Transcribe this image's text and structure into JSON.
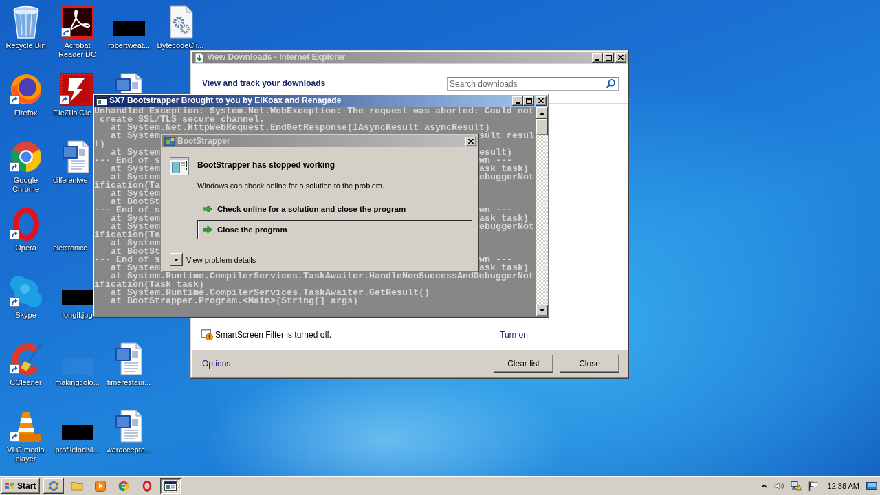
{
  "desktop_icons": [
    {
      "kind": "recyclebin",
      "label": "Recycle Bin",
      "shortcut": false
    },
    {
      "kind": "acrobat",
      "label": "Acrobat Reader DC",
      "shortcut": true
    },
    {
      "kind": "blackimage",
      "label": "robertweat...",
      "shortcut": false
    },
    {
      "kind": "bytecode",
      "label": "BytecodeCli...",
      "shortcut": false
    },
    {
      "kind": "firefox",
      "label": "Firefox",
      "shortcut": true
    },
    {
      "kind": "filezilla",
      "label": "FileZilla Clie",
      "shortcut": true
    },
    {
      "kind": "document",
      "shortcut": false
    },
    {
      "kind": "chrome",
      "label": "Google Chrome",
      "shortcut": true
    },
    {
      "kind": "document",
      "label": "differentwe",
      "shortcut": false
    },
    {
      "kind": "opera",
      "label": "Opera",
      "shortcut": true
    },
    {
      "kind": "blankimage",
      "label": "electronice",
      "shortcut": false
    },
    {
      "kind": "skype",
      "label": "Skype",
      "shortcut": true
    },
    {
      "kind": "blackimage",
      "label": "longfl.jpg",
      "shortcut": false
    },
    {
      "kind": "ccleaner",
      "label": "CCleaner",
      "shortcut": true
    },
    {
      "kind": "faintimage",
      "label": "makingcolo...",
      "shortcut": false
    },
    {
      "kind": "document",
      "label": "timerestaur...",
      "shortcut": false
    },
    {
      "kind": "vlc",
      "label": "VLC media player",
      "shortcut": true
    },
    {
      "kind": "blackimage",
      "label": "profileindivi...",
      "shortcut": false
    },
    {
      "kind": "document",
      "label": "waraccepte...",
      "shortcut": false
    }
  ],
  "downloads_window": {
    "title": "View Downloads - Internet Explorer",
    "active": false,
    "heading": "View and track your downloads",
    "search": {
      "placeholder": "Search downloads"
    },
    "smartscreen": {
      "message": "SmartScreen Filter is turned off.",
      "link": "Turn on"
    },
    "options_link": "Options",
    "buttons": [
      "Clear list",
      "Close"
    ]
  },
  "console_window": {
    "title": "SX7 Bootstrapper Brought to you by ElKoax and Renagade",
    "active": true,
    "lines": [
      {
        "text": "Unhandled Exception: System.Net.WebException: The request was aborted: Could not"
      },
      {
        "text": " create SSL/TLS secure channel."
      },
      {
        "text": "   at System.Net.HttpWebRequest.EndGetResponse(IAsyncResult asyncResult)"
      },
      {
        "left": "   at System",
        "right": "sult resul"
      },
      {
        "left": "t)"
      },
      {
        "left": "   at System",
        "right": "esult)"
      },
      {
        "left": "--- End of s",
        "right": "wn ---"
      },
      {
        "left": "   at System",
        "right": "ask task)"
      },
      {
        "left": "   at System",
        "right": "ebuggerNot"
      },
      {
        "left": "ification(Ta"
      },
      {
        "left": "   at System"
      },
      {
        "left": "   at BootSt"
      },
      {
        "left": "--- End of s",
        "right": "wn ---"
      },
      {
        "left": "   at System",
        "right": "ask task)"
      },
      {
        "left": "   at System",
        "right": "ebuggerNot"
      },
      {
        "left": "ification(Ta"
      },
      {
        "left": "   at System"
      },
      {
        "left": "   at BootSt"
      },
      {
        "left": "--- End of s",
        "right": "wn ---"
      },
      {
        "left": "   at System",
        "right": "ask task)"
      },
      {
        "text": "   at System.Runtime.CompilerServices.TaskAwaiter.HandleNonSuccessAndDebuggerNot"
      },
      {
        "text": "ification(Task task)"
      },
      {
        "text": "   at System.Runtime.CompilerServices.TaskAwaiter.GetResult()"
      },
      {
        "text": "   at BootStrapper.Program.<Main>(String[] args)"
      }
    ]
  },
  "error_dialog": {
    "title": "BootStrapper",
    "active": false,
    "heading": "BootStrapper has stopped working",
    "message": "Windows can check online for a solution to the problem.",
    "options": [
      {
        "label": "Check online for a solution and close the program",
        "selected": false
      },
      {
        "label": "Close the program",
        "selected": true
      }
    ],
    "details_toggle": {
      "label": "View problem details",
      "expanded": false
    }
  },
  "taskbar": {
    "start_button": "Start",
    "items": [
      {
        "kind": "ie",
        "running": true,
        "selected": false
      },
      {
        "kind": "explorer",
        "running": false,
        "selected": false
      },
      {
        "kind": "mediaplayer",
        "running": false,
        "selected": false
      },
      {
        "kind": "chrome",
        "running": false,
        "selected": false
      },
      {
        "kind": "opera",
        "running": false,
        "selected": false
      },
      {
        "kind": "console",
        "running": true,
        "selected": true
      }
    ],
    "clock": "12:38 AM"
  }
}
